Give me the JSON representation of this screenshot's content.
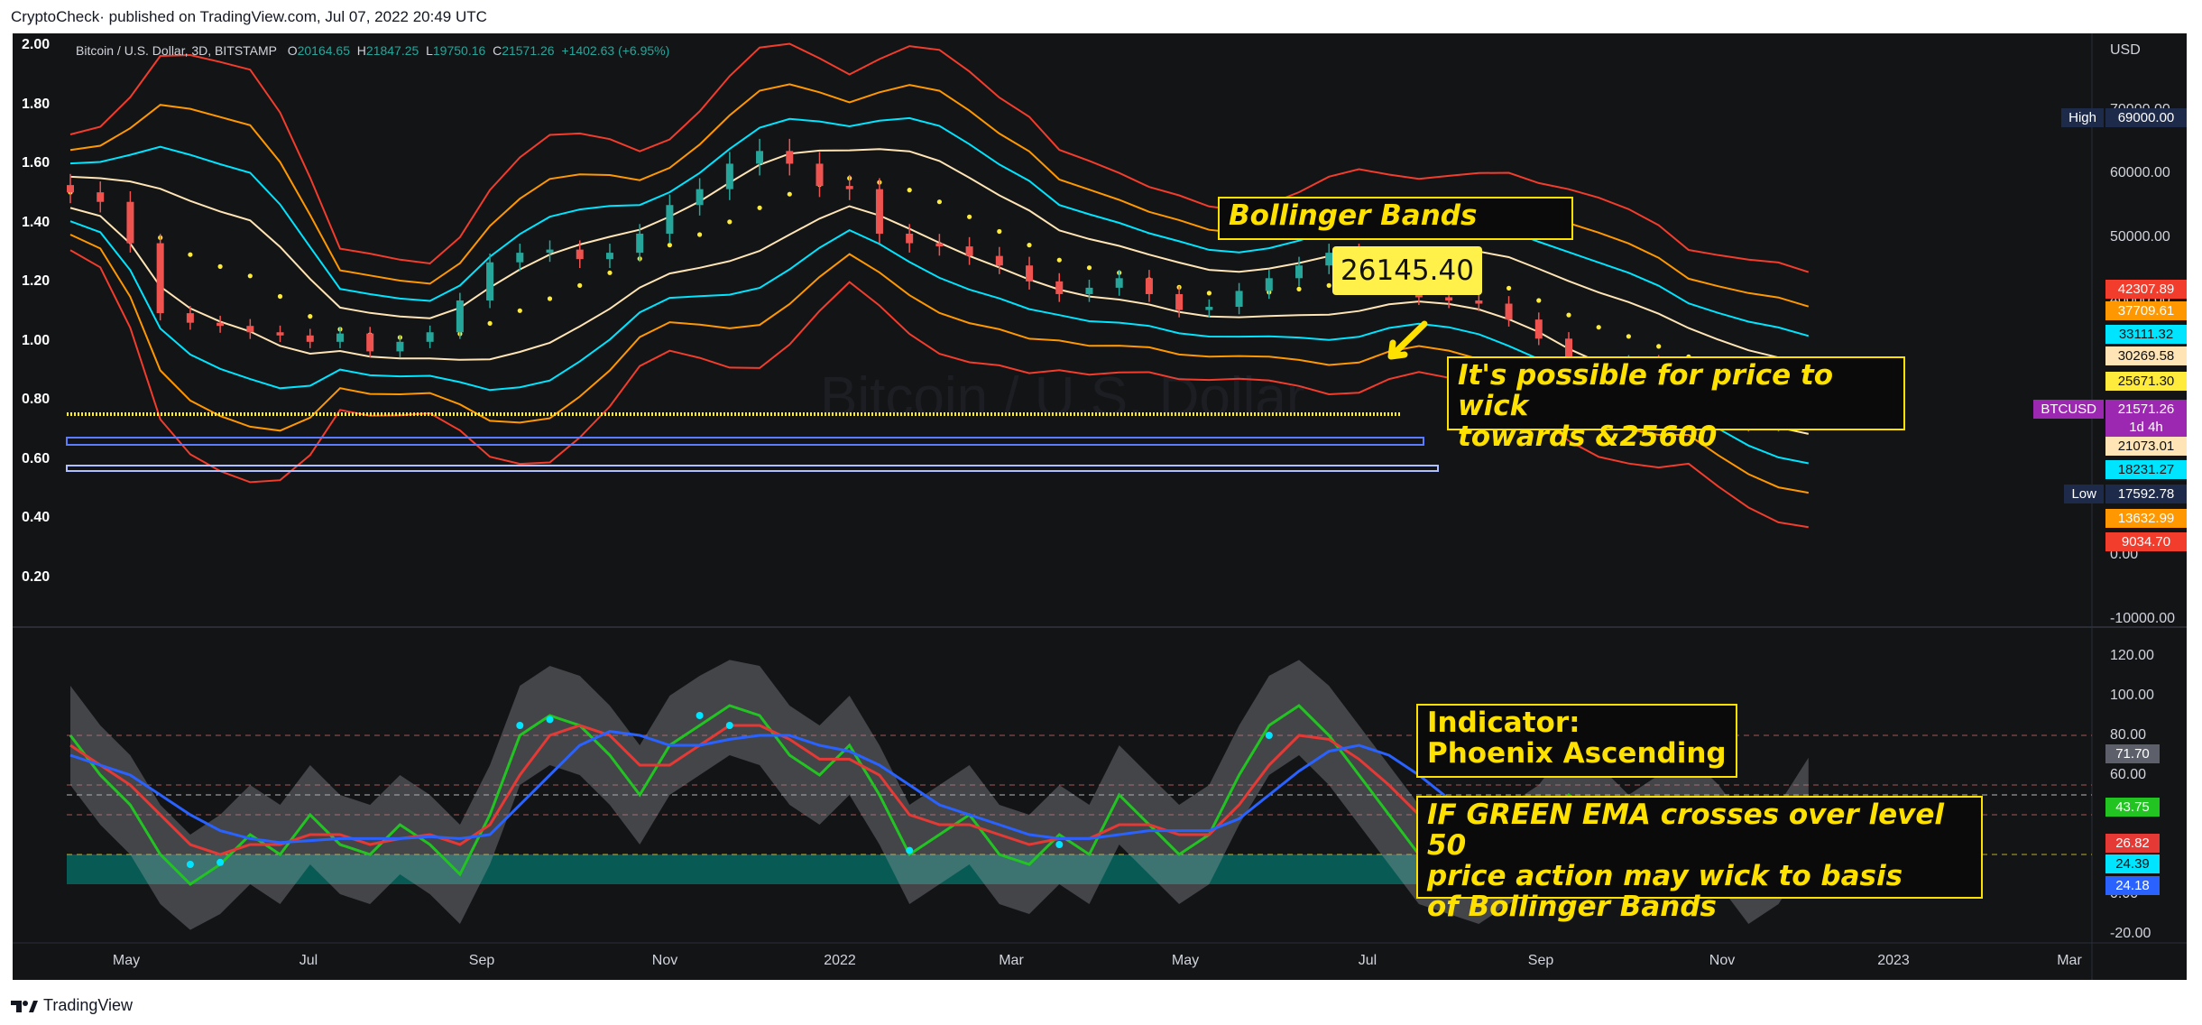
{
  "caption": "CryptoCheck· published on TradingView.com, Jul 07, 2022 20:49 UTC",
  "footer_brand": "TradingView",
  "symbol_line": {
    "title": "Bitcoin / U.S. Dollar, 3D, BITSTAMP",
    "o_label": "O",
    "o": "20164.65",
    "h_label": "H",
    "h": "21847.25",
    "l_label": "L",
    "l": "19750.16",
    "c_label": "C",
    "c": "21571.26",
    "change": "+1402.63 (+6.95%)"
  },
  "watermark": "Bitcoin / U.S. Dollar",
  "annotations": {
    "bollinger": "Bollinger Bands",
    "price_callout": "26145.40",
    "wick_line1": "It's possible for price to wick",
    "wick_line2": "towards &25600",
    "indicator_line1": "Indicator:",
    "indicator_line2": "Phoenix Ascending",
    "ema_line1": "IF GREEN EMA crosses over level 50",
    "ema_line2": "price action may wick to basis",
    "ema_line3": "of Bollinger Bands"
  },
  "colors": {
    "background": "#131416",
    "candle_up": "#26a69a",
    "candle_down": "#ef5350",
    "bb_red": "#f23c2c",
    "bb_orange": "#ff9800",
    "bb_cyan": "#00e5ff",
    "bb_cream": "#ffe4b5",
    "basis": "#ffeb3b",
    "green_ema": "#22c422",
    "red_ema": "#e53935",
    "blue_ema": "#2962ff",
    "annotation": "#ffe100"
  },
  "chart_data": [
    {
      "type": "candlestick",
      "title": "Bitcoin / U.S. Dollar, 3D, BITSTAMP",
      "x_ticks": [
        "May",
        "Jul",
        "Sep",
        "Nov",
        "2022",
        "Mar",
        "May",
        "Jul",
        "Sep",
        "Nov",
        "2023",
        "Mar"
      ],
      "right_axis_unit": "USD",
      "right_axis_ticks": [
        "70000.00",
        "60000.00",
        "50000.00",
        "40000.00",
        "0.00",
        "-10000.00"
      ],
      "left_axis_ticks": [
        "2.00",
        "1.80",
        "1.60",
        "1.40",
        "1.20",
        "1.00",
        "0.80",
        "0.60",
        "0.40",
        "0.20"
      ],
      "ylim": [
        -10000,
        72000
      ],
      "price_labels": [
        {
          "text": "High",
          "value": "69000.00",
          "color": "#1e2a4a"
        },
        {
          "text": "",
          "value": "42307.89",
          "color": "#f23c2c"
        },
        {
          "text": "",
          "value": "37709.61",
          "color": "#ff9800"
        },
        {
          "text": "",
          "value": "33111.32",
          "color": "#00e5ff"
        },
        {
          "text": "",
          "value": "30269.58",
          "color": "#ffe4b5"
        },
        {
          "text": "",
          "value": "25671.30",
          "color": "#ffeb3b"
        },
        {
          "text": "BTCUSD",
          "value": "21571.26",
          "sub": "1d 4h",
          "color": "#9c27b0"
        },
        {
          "text": "",
          "value": "21073.01",
          "color": "#ffe4b5"
        },
        {
          "text": "",
          "value": "18231.27",
          "color": "#00e5ff"
        },
        {
          "text": "Low",
          "value": "17592.78",
          "color": "#1e2a4a"
        },
        {
          "text": "",
          "value": "13632.99",
          "color": "#ff9800"
        },
        {
          "text": "",
          "value": "9034.70",
          "color": "#f23c2c"
        }
      ],
      "series": [
        {
          "name": "",
          "kind": "close",
          "values": [
            57000,
            55500,
            49000,
            38000,
            36500,
            36000,
            35000,
            34500,
            33500,
            34800,
            32000,
            33500,
            35000,
            40000,
            46000,
            47500,
            48000,
            46500,
            47500,
            50500,
            55000,
            57500,
            61500,
            63500,
            61500,
            58000,
            57500,
            50500,
            49000,
            48500,
            47000,
            45500,
            43000,
            41000,
            42000,
            43500,
            41000,
            38500,
            39000,
            41500,
            43500,
            45500,
            47500,
            46000,
            43000,
            40500,
            40000,
            39500,
            37000,
            34000,
            30000,
            29500,
            30500,
            29000,
            28000,
            21500,
            20000,
            20300,
            21571
          ]
        }
      ]
    },
    {
      "type": "line",
      "title": "Phoenix Ascending",
      "right_axis_ticks": [
        "120.00",
        "100.00",
        "80.00",
        "60.00",
        "0.00",
        "-20.00"
      ],
      "ylim": [
        -20,
        125
      ],
      "levels": [
        80,
        50,
        20
      ],
      "price_labels": [
        {
          "value": "71.70",
          "color": "#5d606b"
        },
        {
          "value": "43.75",
          "color": "#22c422"
        },
        {
          "value": "26.82",
          "color": "#e53935"
        },
        {
          "value": "24.39",
          "color": "#00e5ff"
        },
        {
          "value": "24.18",
          "color": "#2962ff"
        }
      ],
      "series": [
        {
          "name": "",
          "kind": "green",
          "values": [
            80,
            60,
            45,
            20,
            5,
            15,
            30,
            20,
            40,
            25,
            20,
            35,
            25,
            10,
            40,
            80,
            90,
            85,
            70,
            50,
            75,
            85,
            95,
            90,
            70,
            60,
            75,
            50,
            20,
            30,
            40,
            20,
            15,
            30,
            20,
            50,
            35,
            20,
            30,
            60,
            85,
            95,
            80,
            60,
            40,
            20,
            15,
            10,
            20,
            30,
            50,
            40,
            25,
            35,
            45,
            30,
            10,
            20,
            43.75
          ]
        },
        {
          "name": "",
          "kind": "red",
          "values": [
            75,
            65,
            55,
            40,
            25,
            20,
            25,
            25,
            30,
            30,
            25,
            28,
            30,
            25,
            35,
            60,
            80,
            85,
            80,
            65,
            65,
            75,
            85,
            85,
            78,
            68,
            68,
            60,
            40,
            35,
            35,
            30,
            25,
            28,
            28,
            35,
            35,
            30,
            30,
            45,
            65,
            80,
            78,
            68,
            55,
            40,
            30,
            25,
            25,
            28,
            35,
            38,
            32,
            32,
            38,
            35,
            25,
            22,
            26.82
          ]
        },
        {
          "name": "",
          "kind": "blue",
          "values": [
            70,
            65,
            60,
            50,
            40,
            32,
            28,
            26,
            27,
            28,
            28,
            28,
            29,
            28,
            30,
            45,
            60,
            75,
            82,
            80,
            75,
            75,
            78,
            80,
            80,
            75,
            72,
            65,
            55,
            45,
            40,
            35,
            30,
            28,
            28,
            30,
            32,
            32,
            32,
            38,
            50,
            62,
            72,
            75,
            70,
            60,
            48,
            38,
            30,
            28,
            28,
            30,
            30,
            30,
            32,
            30,
            27,
            25,
            24.18
          ]
        }
      ]
    }
  ]
}
